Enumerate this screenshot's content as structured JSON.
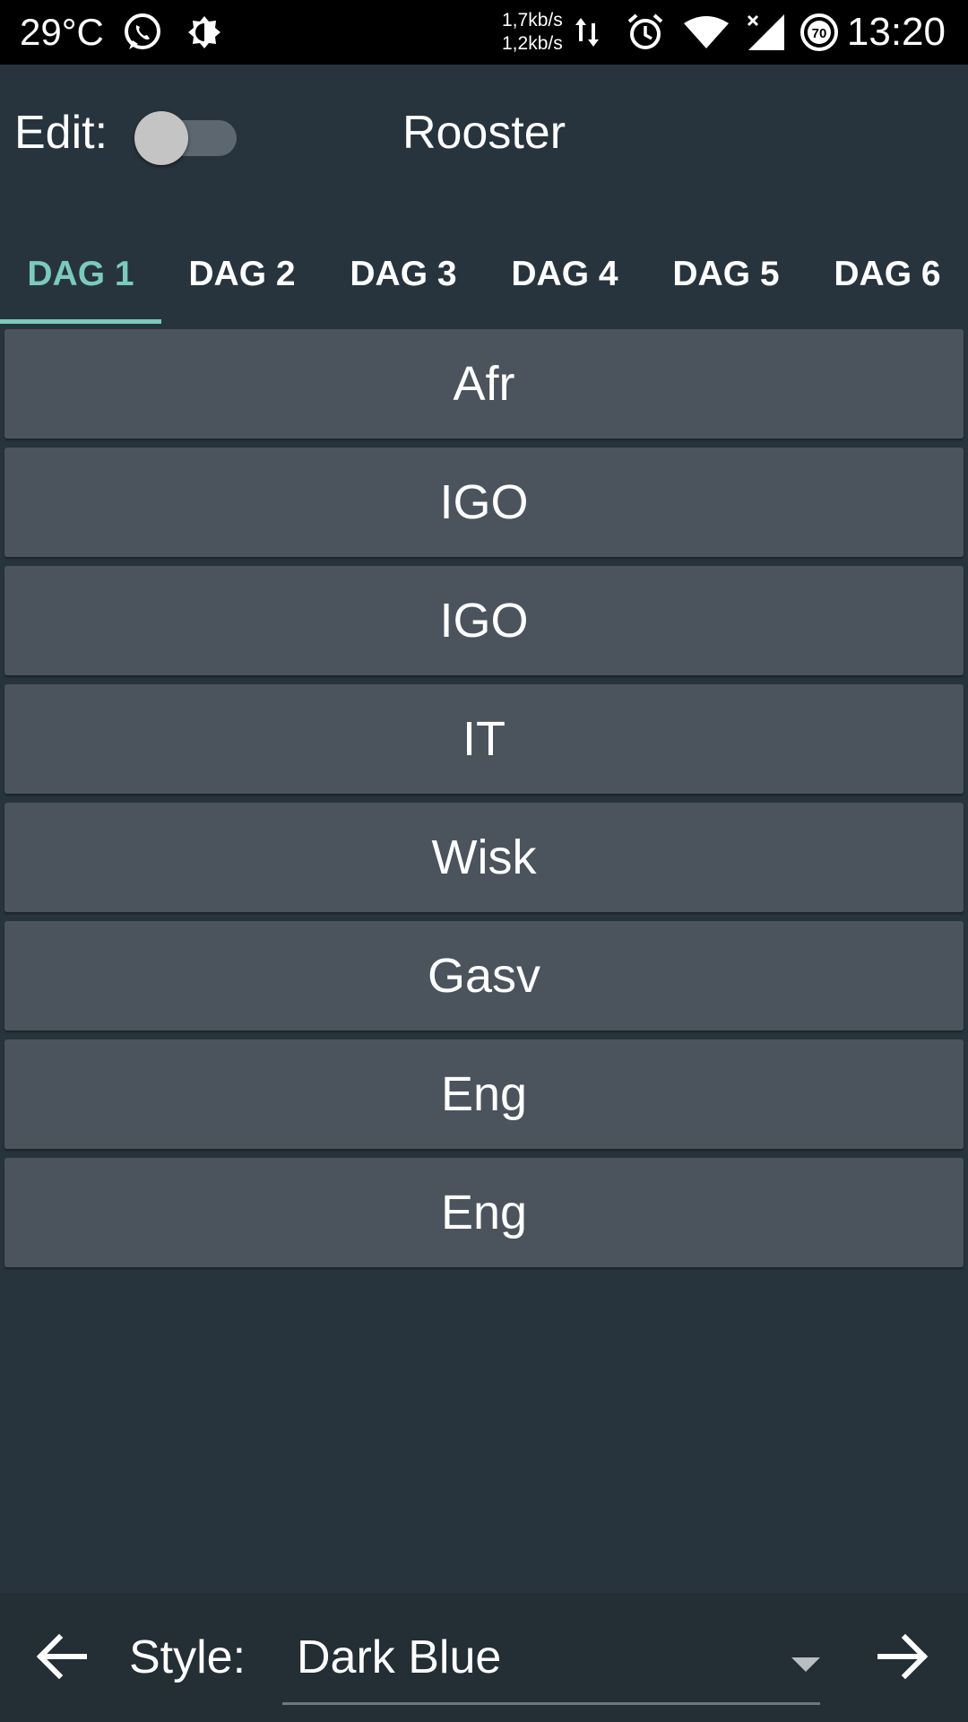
{
  "status_bar": {
    "temperature": "29°C",
    "net_speed_up": "1,7kb/s",
    "net_speed_down": "1,2kb/s",
    "battery_level": "70",
    "time": "13:20",
    "icons": [
      "whatsapp-icon",
      "brightness-icon",
      "data-transfer-icon",
      "alarm-icon",
      "wifi-icon",
      "signal-icon",
      "battery-icon"
    ]
  },
  "header": {
    "edit_label": "Edit:",
    "edit_toggle_on": false,
    "title": "Rooster"
  },
  "tabs": [
    {
      "label": "DAG 1",
      "active": true
    },
    {
      "label": "DAG 2",
      "active": false
    },
    {
      "label": "DAG 3",
      "active": false
    },
    {
      "label": "DAG 4",
      "active": false
    },
    {
      "label": "DAG 5",
      "active": false
    },
    {
      "label": "DAG 6",
      "active": false
    }
  ],
  "schedule": [
    {
      "subject": "Afr"
    },
    {
      "subject": "IGO"
    },
    {
      "subject": "IGO"
    },
    {
      "subject": "IT"
    },
    {
      "subject": "Wisk"
    },
    {
      "subject": "Gasv"
    },
    {
      "subject": "Eng"
    },
    {
      "subject": "Eng"
    }
  ],
  "footer": {
    "style_label": "Style:",
    "style_value": "Dark Blue"
  },
  "colors": {
    "background": "#28343d",
    "accent": "#7ccabd",
    "row": "#4b545c",
    "bottom_bar": "#232e35"
  }
}
